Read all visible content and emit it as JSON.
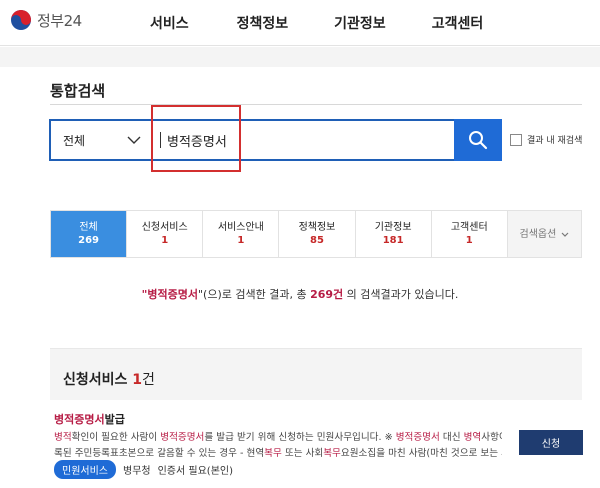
{
  "header": {
    "logo_text": "정부24",
    "nav": [
      "서비스",
      "정책정보",
      "기관정보",
      "고객센터"
    ]
  },
  "page_title": "통합검색",
  "search": {
    "scope": "전체",
    "query": "병적증명서",
    "resubmit_label": "결과 내 재검색"
  },
  "tabs": [
    {
      "label": "전체",
      "count": "269"
    },
    {
      "label": "신청서비스",
      "count": "1"
    },
    {
      "label": "서비스안내",
      "count": "1"
    },
    {
      "label": "정책정보",
      "count": "85"
    },
    {
      "label": "기관정보",
      "count": "181"
    },
    {
      "label": "고객센터",
      "count": "1"
    }
  ],
  "tab_options": "검색옵션",
  "summary": {
    "open_quote": "\"",
    "keyword": "병적증명서",
    "middle": "\"(으)로 검색한 결과, 총 ",
    "total": "269건",
    "end": " 의 검색결과가 있습니다."
  },
  "section": {
    "title": "신청서비스",
    "count": "1",
    "unit": "건"
  },
  "result": {
    "title_kw": "병적증명서",
    "title_rest": "발급",
    "line1": {
      "a": "병적",
      "b": "확인이 필요한 사람이 ",
      "c": "병적증명서",
      "d": "를 발급 받기 위해 신청하는 민원사무입니다. ※ ",
      "e": "병적증명서",
      "f": " 대신 ",
      "g": "병역",
      "h": "사항이 기"
    },
    "line2": {
      "a": "록된 주민등록표초본으로 갈음할 수 있는 경우 - 현역",
      "b": "복무",
      "c": " 또는 사회",
      "d": "복무",
      "e": "요원소집을 마친 사람(마친 것으로 보는 사람"
    },
    "apply_label": "신청",
    "badge": "민원서비스",
    "agency": "병무청",
    "requirement": "인증서 필요(본인)"
  },
  "colors": {
    "primary": "#1f6bd6",
    "tab_active": "#3a8ee0",
    "keyword": "#b71c45",
    "apply_button": "#1f3c70",
    "highlight": "#d32f2f"
  }
}
